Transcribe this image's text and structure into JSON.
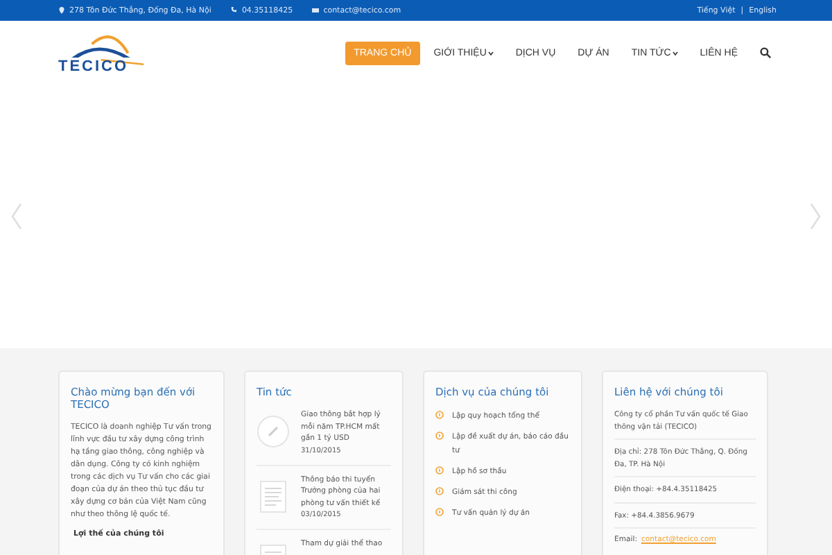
{
  "top_bar": {
    "address": "278 Tôn Đức Thắng, Đống Đa, Hà Nội",
    "phone": "04.35118425",
    "email": "contact@tecico.com",
    "languages": [
      "Tiếng Việt",
      "English"
    ],
    "separator": "|"
  },
  "header": {
    "logo_text": "TECICO",
    "nav": [
      {
        "label": "TRANG CHỦ",
        "selected": true,
        "dropdown": false
      },
      {
        "label": "GIỚI THIỆU",
        "selected": false,
        "dropdown": true
      },
      {
        "label": "DỊCH VỤ",
        "selected": false,
        "dropdown": false
      },
      {
        "label": "DỰ ÁN",
        "selected": false,
        "dropdown": false
      },
      {
        "label": "TIN TỨC",
        "selected": false,
        "dropdown": true
      },
      {
        "label": "LIÊN HỆ",
        "selected": false,
        "dropdown": false
      }
    ]
  },
  "welcome": {
    "title": "Chào mừng bạn đến với TECICO",
    "body": "TECICO là doanh nghiệp Tư vấn trong lĩnh vực đầu tư xây dựng công trình hạ tầng giao thông, công nghiệp và dân dụng. Công ty có kinh nghiệm trong các dịch vụ Tư vấn cho các giai đoạn của dự án theo thủ tục đầu tư xây dựng cơ bản của Việt Nam cũng như theo thông lệ quốc tế.",
    "subtitle": "Lợi thế của chúng tôi"
  },
  "news": {
    "title": "Tin tức",
    "items": [
      {
        "kind": "pencil",
        "title": "Giao thông bắt hợp lý mỗi năm TP.HCM mất gần 1 tỷ USD",
        "date": "31/10/2015"
      },
      {
        "kind": "document",
        "title": "Thông báo thi tuyển Trưởng phòng của hai phòng tư vấn thiết kế",
        "date": "03/10/2015"
      },
      {
        "kind": "document",
        "title": "Tham dự giải thể thao"
      }
    ]
  },
  "services": {
    "title": "Dịch vụ của chúng tôi",
    "items": [
      "Lập quy hoạch tổng thể",
      "Lập đề xuất dự án, báo cáo đầu tư",
      "Lập hồ sơ thầu",
      "Giám sát thi công",
      "Tư vấn quản lý dự án"
    ]
  },
  "contact": {
    "title": "Liên hệ với chúng tôi",
    "lines": [
      "Công ty cổ phần Tư vấn quốc tế Giao thông vận tải (TECICO)",
      "Địa chỉ: 278 Tôn Đức Thắng, Q. Đống Đa, TP. Hà Nội",
      "Điện thoại: +84.4.35118425",
      "Fax: +84.4.3856.9679"
    ],
    "email_label": "Email:",
    "email": "contact@tecico.com"
  }
}
